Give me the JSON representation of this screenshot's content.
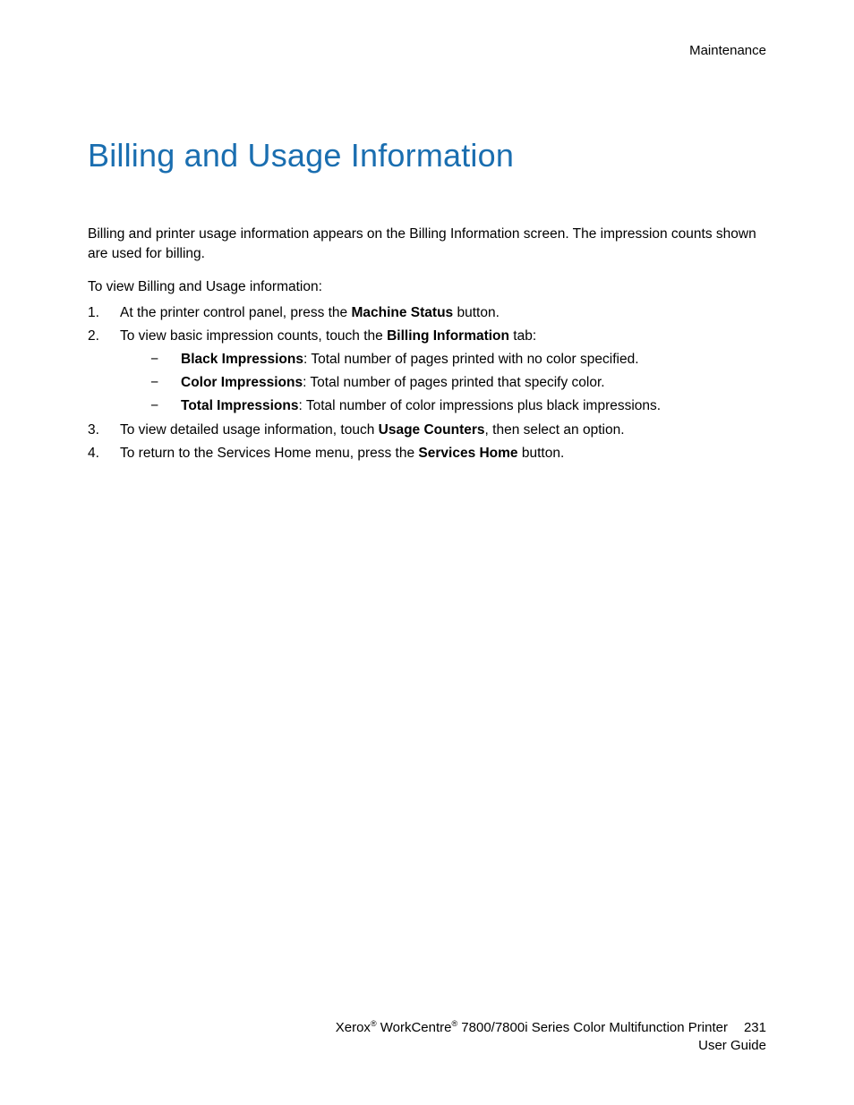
{
  "header": {
    "section": "Maintenance"
  },
  "title": "Billing and Usage Information",
  "intro": "Billing and printer usage information appears on the Billing Information screen. The impression counts shown are used for billing.",
  "lead": "To view Billing and Usage information:",
  "steps": {
    "s1_a": "At the printer control panel, press the ",
    "s1_b": "Machine Status",
    "s1_c": " button.",
    "s2_a": "To view basic impression counts, touch the ",
    "s2_b": "Billing Information",
    "s2_c": " tab:",
    "sub1_b": "Black Impressions",
    "sub1_t": ": Total number of pages printed with no color specified.",
    "sub2_b": "Color Impressions",
    "sub2_t": ": Total number of pages printed that specify color.",
    "sub3_b": "Total Impressions",
    "sub3_t": ": Total number of color impressions plus black impressions.",
    "s3_a": "To view detailed usage information, touch ",
    "s3_b": "Usage Counters",
    "s3_c": ", then select an option.",
    "s4_a": "To return to the Services Home menu, press the ",
    "s4_b": "Services Home",
    "s4_c": " button."
  },
  "footer": {
    "brand1": "Xerox",
    "reg": "®",
    "brand2": " WorkCentre",
    "model": " 7800/7800i Series Color Multifunction Printer",
    "page": "231",
    "guide": "User Guide"
  }
}
